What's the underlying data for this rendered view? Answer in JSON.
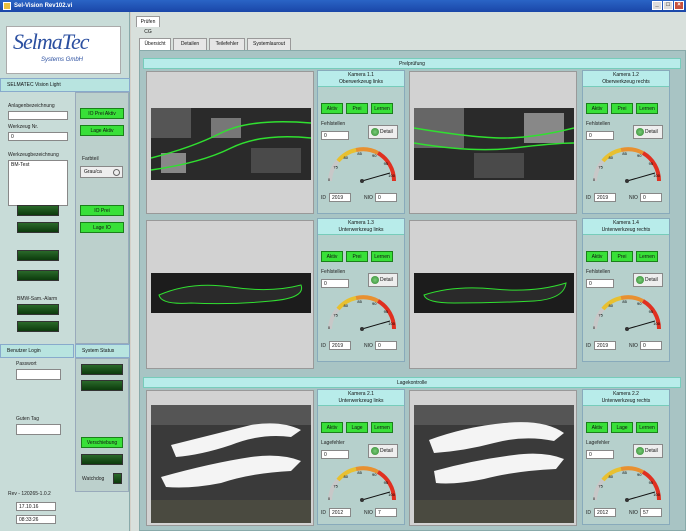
{
  "window": {
    "title": "Sel-Vision Rev102.vi"
  },
  "left": {
    "logo_main": "SelmaTec",
    "logo_sub": "Systems GmbH",
    "app_name": "SELMATEC Vision Light",
    "anlagen_label": "Anlagenbezeichnung",
    "werkzeug_label": "Werkzeug Nr.",
    "werkzeug_value": "0",
    "werkzeugbez_label": "Werkzeugbezeichnung",
    "werkzeugbez_value": "BM-Test",
    "btn_io_prei_aktiv": "IO Prei Aktiv",
    "btn_lage_aktiv": "Lage Aktiv",
    "farbteil_label": "Farbteil",
    "farbteil_value": "Grau/ca",
    "btn_io_prei": "IO Prei",
    "btn_lage_io": "Lage IO",
    "bmw_alarm": "BMW-Sam.-Alarm",
    "login_header": "Benutzer Login",
    "status_header": "System Status",
    "passwort_label": "Passwort",
    "guten_tag": "Guten Tag",
    "btn_verschiebung": "Verschiebung",
    "watchdog": "Watchdog",
    "rev": "Rev - 120265-1.0.2",
    "date": "17.10.16",
    "time": "08:33:26"
  },
  "tabs": {
    "outer": "Prüfen CG",
    "items": [
      "Übersicht",
      "Detailen",
      "Teilefehler",
      "Systemlaurout"
    ]
  },
  "sections": {
    "top": "Prelprüfung",
    "bottom": "Lagekontrolle"
  },
  "cameras": [
    {
      "title": "Kamera 1.1",
      "subtitle": "Oberwerkzeug links",
      "b1": "Aktiv",
      "b2": "Prei",
      "b3": "Lernen",
      "fehler_label": "Fehlstellen",
      "fehler_value": "0",
      "detail": "Detail",
      "id_label": "ID",
      "id_value": "2019",
      "nio_label": "NIO",
      "nio_value": "0"
    },
    {
      "title": "Kamera 1.2",
      "subtitle": "Oberwerkzeug rechts",
      "b1": "Aktiv",
      "b2": "Prei",
      "b3": "Lernen",
      "fehler_label": "Fehlstellen",
      "fehler_value": "0",
      "detail": "Detail",
      "id_label": "ID",
      "id_value": "2019",
      "nio_label": "NIO",
      "nio_value": "0"
    },
    {
      "title": "Kamera 1.3",
      "subtitle": "Unterwerkzeug links",
      "b1": "Aktiv",
      "b2": "Prei",
      "b3": "Lernen",
      "fehler_label": "Fehlstellen",
      "fehler_value": "0",
      "detail": "Detail",
      "id_label": "ID",
      "id_value": "2019",
      "nio_label": "NIO",
      "nio_value": "0"
    },
    {
      "title": "Kamera 1.4",
      "subtitle": "Unterwerkzeug rechts",
      "b1": "Aktiv",
      "b2": "Prei",
      "b3": "Lernen",
      "fehler_label": "Fehlstellen",
      "fehler_value": "0",
      "detail": "Detail",
      "id_label": "ID",
      "id_value": "2019",
      "nio_label": "NIO",
      "nio_value": "0"
    },
    {
      "title": "Kamera 2.1",
      "subtitle": "Unterwerkzeug links",
      "b1": "Aktiv",
      "b2": "Lage",
      "b3": "Lernen",
      "fehler_label": "Lagefehler",
      "fehler_value": "0",
      "detail": "Detail",
      "id_label": "ID",
      "id_value": "2012",
      "nio_label": "NIO",
      "nio_value": "7"
    },
    {
      "title": "Kamera 2.2",
      "subtitle": "Unterwerkzeug rechts",
      "b1": "Aktiv",
      "b2": "Lage",
      "b3": "Lernen",
      "fehler_label": "Lagefehler",
      "fehler_value": "0",
      "detail": "Detail",
      "id_label": "ID",
      "id_value": "2012",
      "nio_label": "NIO",
      "nio_value": "57"
    }
  ],
  "gauge": {
    "ticks": [
      "0",
      "75",
      "80",
      "85",
      "90",
      "95",
      "100"
    ]
  },
  "colors": {
    "green_button": "#38e038",
    "header_cyan": "#b8ecea",
    "gauge_red": "#e03020"
  }
}
